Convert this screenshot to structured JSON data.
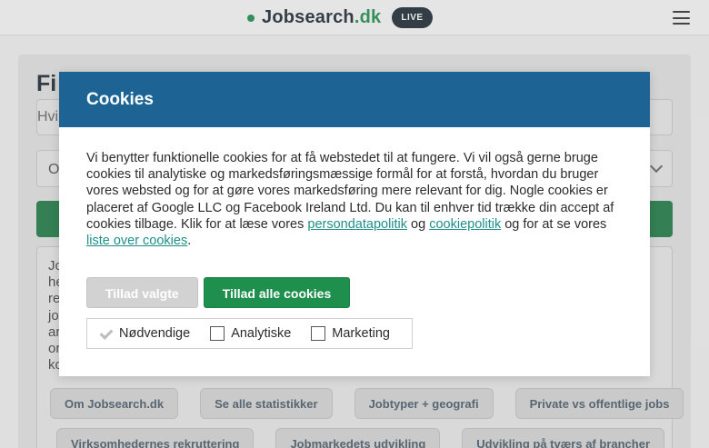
{
  "header": {
    "logo_main": "Jobsearch",
    "logo_tld": ".dk",
    "live_badge": "LIVE"
  },
  "background": {
    "title": "Fi",
    "search_placeholder": "Hvi",
    "select_text": "O",
    "text_fragments": [
      "Jo",
      "he",
      "re",
      "jo",
      "ar",
      "or",
      "ko"
    ],
    "pills_row1": [
      "Om Jobsearch.dk",
      "Se alle statistikker",
      "Jobtyper + geografi",
      "Private vs offentlige jobs"
    ],
    "pills_row2": [
      "Virksomhedernes rekruttering",
      "Jobmarkedets udvikling",
      "Udvikling på tværs af brancher"
    ]
  },
  "cookie_modal": {
    "title": "Cookies",
    "body_text": "Vi benytter funktionelle cookies for at få webstedet til at fungere. Vi vil også gerne bruge cookies til analytiske og markedsføringsmæssige formål for at forstå, hvordan du bruger vores websted og for at gøre vores markedsføring mere relevant for dig. Nogle cookies er placeret af Google LLC og Facebook Ireland Ltd. Du kan til enhver tid trække din accept af cookies tilbage. Klik for at læse vores ",
    "link_privacy": "persondatapolitik",
    "text_and": " og ",
    "link_cookiepolicy": "cookiepolitik",
    "text_after": " og for at se vores ",
    "link_cookielist": "liste over cookies",
    "text_end": ".",
    "btn_allow_selected": "Tillad valgte",
    "btn_allow_all": "Tillad alle cookies",
    "checkboxes": [
      {
        "label": "Nødvendige",
        "checked": true
      },
      {
        "label": "Analytiske",
        "checked": false
      },
      {
        "label": "Marketing",
        "checked": false
      }
    ]
  },
  "colors": {
    "brand_green": "#1f8f4e",
    "modal_header_blue": "#1d6495",
    "link_teal": "#1f8f8a"
  }
}
